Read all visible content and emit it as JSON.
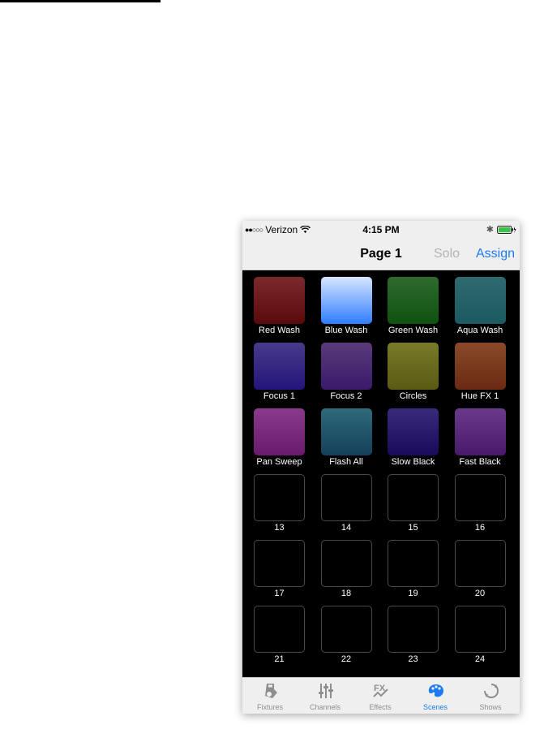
{
  "status": {
    "signal": "●●○○○",
    "carrier": "Verizon",
    "time": "4:15 PM"
  },
  "nav": {
    "title": "Page 1",
    "solo": "Solo",
    "assign": "Assign"
  },
  "scenes": [
    {
      "label": "Red Wash",
      "top": "#7a2a2a",
      "bottom": "#5a0a0a"
    },
    {
      "label": "Blue Wash",
      "top": "#d6e6ff",
      "bottom": "#2f7cff"
    },
    {
      "label": "Green Wash",
      "top": "#2f6a2f",
      "bottom": "#0f520f"
    },
    {
      "label": "Aqua Wash",
      "top": "#2f6a70",
      "bottom": "#1a5a60"
    },
    {
      "label": "Focus 1",
      "top": "#4a3a8a",
      "bottom": "#22157a"
    },
    {
      "label": "Focus 2",
      "top": "#5a3a7a",
      "bottom": "#3a1a6a"
    },
    {
      "label": "Circles",
      "top": "#7a7a2a",
      "bottom": "#5a5a12"
    },
    {
      "label": "Hue FX 1",
      "top": "#8a4a2a",
      "bottom": "#6a2a12"
    },
    {
      "label": "Pan Sweep",
      "top": "#8a3a8a",
      "bottom": "#6a1a6a"
    },
    {
      "label": "Flash All",
      "top": "#2f6a7a",
      "bottom": "#153f5a"
    },
    {
      "label": "Slow Black",
      "top": "#3a2a7a",
      "bottom": "#1a0a5a"
    },
    {
      "label": "Fast Black",
      "top": "#6a3a8a",
      "bottom": "#4a1a6a"
    },
    {
      "label": "13"
    },
    {
      "label": "14"
    },
    {
      "label": "15"
    },
    {
      "label": "16"
    },
    {
      "label": "17"
    },
    {
      "label": "18"
    },
    {
      "label": "19"
    },
    {
      "label": "20"
    },
    {
      "label": "21"
    },
    {
      "label": "22"
    },
    {
      "label": "23"
    },
    {
      "label": "24"
    }
  ],
  "tabs": [
    {
      "label": "Fixtures",
      "icon": "fixtures-icon"
    },
    {
      "label": "Channels",
      "icon": "channels-icon"
    },
    {
      "label": "Effects",
      "icon": "effects-icon"
    },
    {
      "label": "Scenes",
      "icon": "scenes-icon",
      "active": true
    },
    {
      "label": "Shows",
      "icon": "shows-icon"
    }
  ],
  "colors": {
    "accent": "#1a7cf2",
    "inactive": "#8e8e8e"
  }
}
